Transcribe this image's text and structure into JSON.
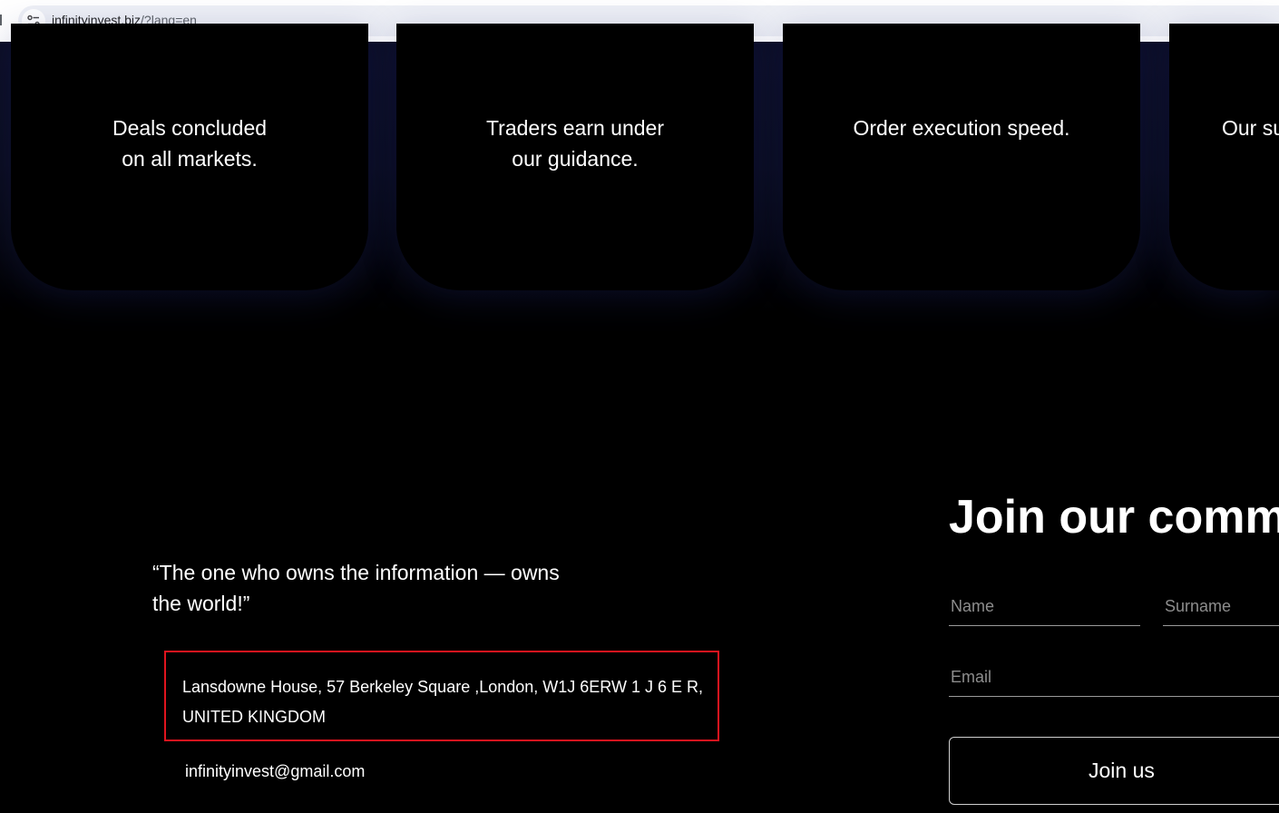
{
  "browser": {
    "url_host": "infinityinvest.biz",
    "url_path": "/?lang=en"
  },
  "cards": [
    {
      "line1": "Deals concluded",
      "line2": "on all markets."
    },
    {
      "line1": "Traders earn under",
      "line2": "our guidance."
    },
    {
      "line1": "Order execution speed.",
      "line2": ""
    },
    {
      "line1": "Our su",
      "line2": ""
    }
  ],
  "footer": {
    "quote_line1": "“The one who owns the information — owns",
    "quote_line2": "the world!”",
    "address_line1": "Lansdowne House, 57 Berkeley Square ,London, W1J 6ERW 1 J 6 E R,",
    "address_line2": "UNITED KINGDOM",
    "email": "infinityinvest@gmail.com"
  },
  "signup": {
    "title": "Join our commu",
    "name_placeholder": "Name",
    "surname_placeholder": "Surname",
    "email_placeholder": "Email",
    "button_label": "Join us"
  },
  "colors": {
    "background": "#000000",
    "text": "#ffffff",
    "highlight_border": "#e0141e",
    "card_glow": "#0b0d24"
  }
}
